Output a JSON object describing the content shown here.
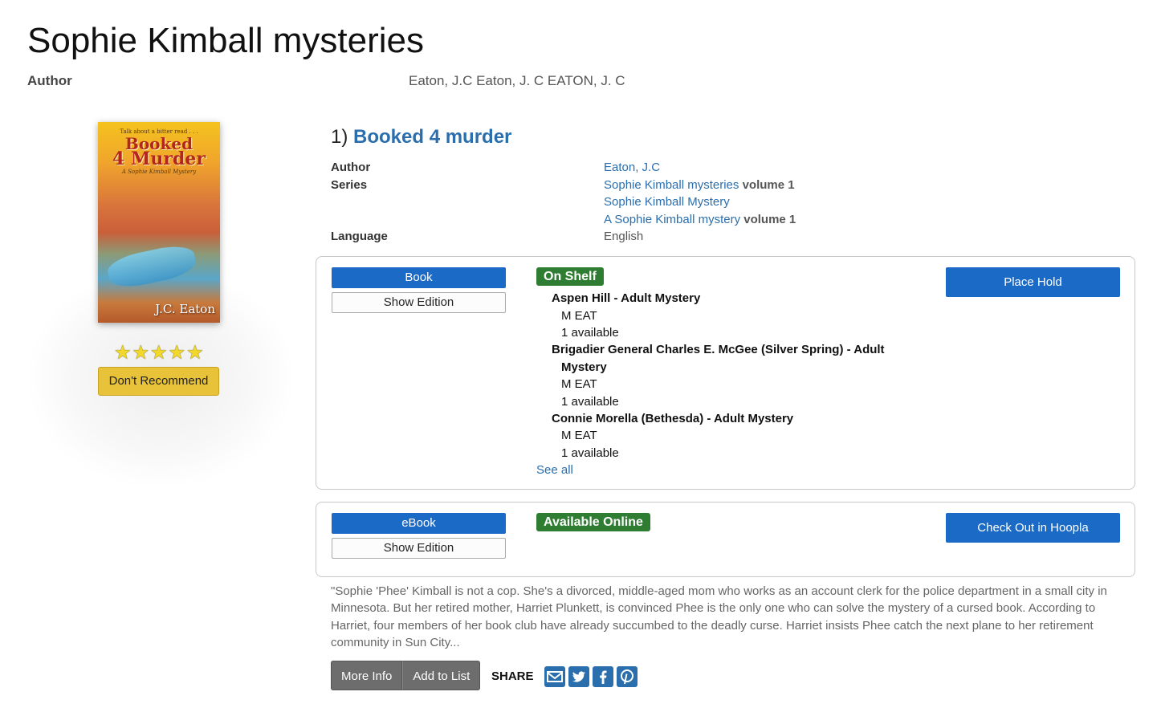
{
  "series": {
    "title": "Sophie Kimball mysteries",
    "author_label": "Author",
    "authors": "Eaton, J.C Eaton, J. C EATON, J. C"
  },
  "cover": {
    "tagline": "Talk about a bitter read . . .",
    "title_line1": "Booked",
    "title_line2": "4 Murder",
    "subtitle": "A Sophie Kimball Mystery",
    "author": "J.C. Eaton"
  },
  "rating": {
    "stars": 5
  },
  "dont_recommend_label": "Don't Recommend",
  "book": {
    "number": "1)",
    "title": "Booked 4 murder",
    "author_label": "Author",
    "author": "Eaton, J.C",
    "series_label": "Series",
    "series": [
      {
        "name": "Sophie Kimball mysteries",
        "volume": "volume 1"
      },
      {
        "name": "Sophie Kimball Mystery",
        "volume": ""
      },
      {
        "name": "A Sophie Kimball mystery",
        "volume": "volume 1"
      }
    ],
    "language_label": "Language",
    "language": "English"
  },
  "formats": [
    {
      "format": "Book",
      "edition_label": "Show Edition",
      "status": "On Shelf",
      "status_color": "#2e7d32",
      "action": "Place Hold",
      "locations": [
        {
          "name_line1": "Aspen Hill - Adult Mystery",
          "name_line2": "",
          "call_number": "M EAT",
          "availability": "1 available"
        },
        {
          "name_line1": "Brigadier General Charles E. McGee (Silver Spring) - Adult",
          "name_line2": "Mystery",
          "call_number": "M EAT",
          "availability": "1 available"
        },
        {
          "name_line1": "Connie Morella (Bethesda) - Adult Mystery",
          "name_line2": "",
          "call_number": "M EAT",
          "availability": "1 available"
        }
      ],
      "see_all": "See all"
    },
    {
      "format": "eBook",
      "edition_label": "Show Edition",
      "status": "Available Online",
      "status_color": "#2e7d32",
      "action": "Check Out in Hoopla"
    }
  ],
  "description": "\"Sophie 'Phee' Kimball is not a cop. She's a divorced, middle-aged mom who works as an account clerk for the police department in a small city in Minnesota. But her retired mother, Harriet Plunkett, is convinced Phee is the only one who can solve the mystery of a cursed book. According to Harriet, four members of her book club have already succumbed to the deadly curse. Harriet insists Phee catch the next plane to her retirement community in Sun City...",
  "actions": {
    "more_info": "More Info",
    "add_to_list": "Add to List",
    "share": "SHARE"
  },
  "share_icons": [
    "email-icon",
    "twitter-icon",
    "facebook-icon",
    "pinterest-icon"
  ],
  "colors": {
    "link": "#2a6ead",
    "primary_button": "#1b6ac6",
    "warning_button": "#e8c339"
  }
}
